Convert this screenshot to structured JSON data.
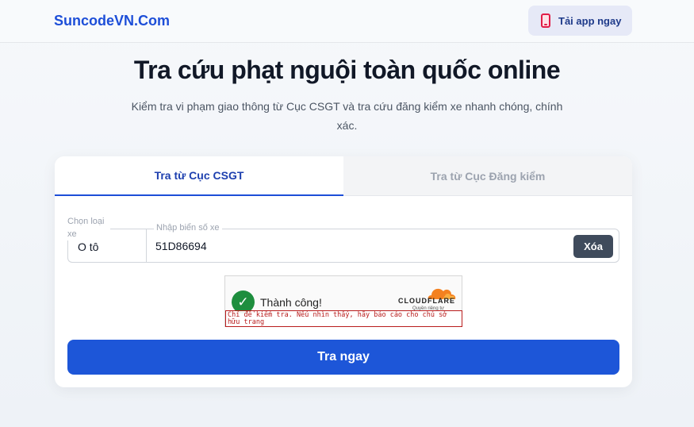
{
  "header": {
    "brand": "SuncodeVN.Com",
    "app_button_label": "Tải app ngay",
    "app_button_icon": "phone-icon"
  },
  "hero": {
    "title": "Tra cứu phạt nguội toàn quốc online",
    "subtitle": "Kiểm tra vi phạm giao thông từ Cục CSGT và tra cứu đăng kiểm xe nhanh chóng, chính xác."
  },
  "tabs": [
    {
      "label": "Tra từ Cục CSGT",
      "active": true
    },
    {
      "label": "Tra từ Cục Đăng kiểm",
      "active": false
    }
  ],
  "form": {
    "vehicle_type_label": "Chọn loại xe",
    "vehicle_type_value": "O tô",
    "plate_label": "Nhập biển số xe",
    "plate_value": "51D86694",
    "clear_label": "Xóa",
    "submit_label": "Tra ngay"
  },
  "captcha": {
    "status": "Thành công!",
    "provider": "CLOUDFLARE",
    "provider_small": "Quyền riêng tư",
    "warning": "Chỉ để kiểm tra. Nếu nhìn thấy, hãy báo cáo cho chủ sở hữu trang"
  },
  "colors": {
    "brand": "#1d4ed8",
    "primary_button": "#1d56d8",
    "success": "#1e8e3e",
    "cloudflare_orange": "#f48120"
  }
}
